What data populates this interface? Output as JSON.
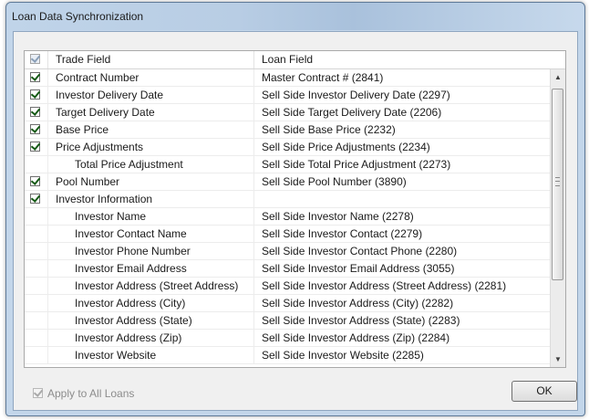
{
  "window": {
    "title": "Loan Data Synchronization"
  },
  "grid": {
    "header": {
      "checked": true,
      "trade_field": "Trade Field",
      "loan_field": "Loan Field"
    },
    "rows": [
      {
        "checkbox": true,
        "checked": true,
        "indent": false,
        "trade": "Contract Number",
        "loan": "Master Contract # (2841)"
      },
      {
        "checkbox": true,
        "checked": true,
        "indent": false,
        "trade": "Investor Delivery Date",
        "loan": "Sell Side Investor Delivery Date (2297)"
      },
      {
        "checkbox": true,
        "checked": true,
        "indent": false,
        "trade": "Target Delivery Date",
        "loan": "Sell Side Target Delivery Date (2206)"
      },
      {
        "checkbox": true,
        "checked": true,
        "indent": false,
        "trade": "Base Price",
        "loan": "Sell Side Base Price (2232)"
      },
      {
        "checkbox": true,
        "checked": true,
        "indent": false,
        "trade": "Price Adjustments",
        "loan": "Sell Side Price Adjustments (2234)"
      },
      {
        "checkbox": false,
        "checked": false,
        "indent": true,
        "trade": "Total Price Adjustment",
        "loan": "Sell Side Total Price Adjustment (2273)"
      },
      {
        "checkbox": true,
        "checked": true,
        "indent": false,
        "trade": "Pool Number",
        "loan": "Sell Side Pool Number (3890)"
      },
      {
        "checkbox": true,
        "checked": true,
        "indent": false,
        "trade": "Investor Information",
        "loan": ""
      },
      {
        "checkbox": false,
        "checked": false,
        "indent": true,
        "trade": "Investor Name",
        "loan": "Sell Side Investor Name (2278)"
      },
      {
        "checkbox": false,
        "checked": false,
        "indent": true,
        "trade": "Investor Contact Name",
        "loan": "Sell Side Investor Contact (2279)"
      },
      {
        "checkbox": false,
        "checked": false,
        "indent": true,
        "trade": "Investor Phone Number",
        "loan": "Sell Side Investor Contact Phone (2280)"
      },
      {
        "checkbox": false,
        "checked": false,
        "indent": true,
        "trade": "Investor Email Address",
        "loan": "Sell Side Investor Email Address (3055)"
      },
      {
        "checkbox": false,
        "checked": false,
        "indent": true,
        "trade": "Investor Address (Street Address)",
        "loan": "Sell Side Investor Address (Street Address) (2281)"
      },
      {
        "checkbox": false,
        "checked": false,
        "indent": true,
        "trade": "Investor Address (City)",
        "loan": "Sell Side Investor Address (City) (2282)"
      },
      {
        "checkbox": false,
        "checked": false,
        "indent": true,
        "trade": "Investor Address (State)",
        "loan": "Sell Side Investor Address (State) (2283)"
      },
      {
        "checkbox": false,
        "checked": false,
        "indent": true,
        "trade": "Investor Address (Zip)",
        "loan": "Sell Side Investor Address (Zip) (2284)"
      },
      {
        "checkbox": false,
        "checked": false,
        "indent": true,
        "trade": "Investor Website",
        "loan": "Sell Side Investor Website (2285)"
      }
    ]
  },
  "scrollbar": {
    "up_icon": "scroll-up-arrow",
    "down_icon": "scroll-down-arrow"
  },
  "footer": {
    "apply_all_label": "Apply to All Loans",
    "apply_all_checked": true,
    "apply_all_disabled": true,
    "ok_label": "OK"
  }
}
